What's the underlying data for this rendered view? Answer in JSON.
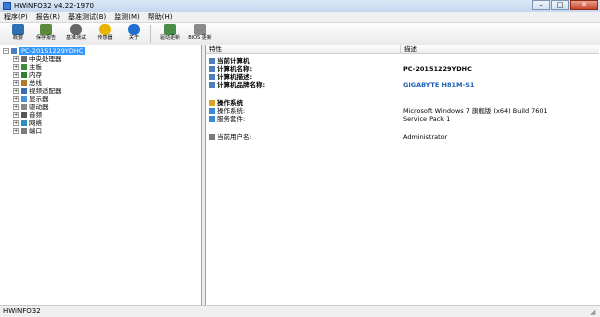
{
  "window": {
    "title": "HWiNFO32 v4.22-1970",
    "minimize": "–",
    "maximize": "□",
    "close": "✕"
  },
  "menu": [
    "程序(P)",
    "报告(R)",
    "基准测试(B)",
    "监测(M)",
    "帮助(H)"
  ],
  "toolbar": [
    {
      "label": "概要",
      "icon": "summary-icon",
      "color": "#2f6fb3"
    },
    {
      "label": "保存报告",
      "icon": "save-report-icon",
      "color": "#5a8a3a"
    },
    {
      "label": "基准测试",
      "icon": "benchmark-icon",
      "color": "#666666"
    },
    {
      "label": "传感器",
      "icon": "sensors-icon",
      "color": "#e8b400"
    },
    {
      "label": "关于",
      "icon": "about-icon",
      "color": "#1f6fd0"
    },
    {
      "label": "驱动更新",
      "icon": "driver-update-icon",
      "color": "#4a8c4a"
    },
    {
      "label": "BIOS 更新",
      "icon": "bios-update-icon",
      "color": "#8a8a8a"
    }
  ],
  "tree": {
    "root": "PC-20151229YDHC",
    "items": [
      "中央处理器",
      "主板",
      "内存",
      "总线",
      "视频适配器",
      "显示器",
      "驱动器",
      "音频",
      "网络",
      "端口"
    ]
  },
  "details": {
    "col_feature": "特性",
    "col_desc": "描述",
    "computer_section": "当前计算机",
    "rows": [
      {
        "label": "计算机名称:",
        "value": "PC-20151229YDHC",
        "bold": true
      },
      {
        "label": "计算机描述:",
        "value": "",
        "bold": true
      },
      {
        "label": "计算机品牌名称:",
        "value": "GIGABYTE H81M-S1",
        "link": true
      }
    ],
    "os_section": "操作系统",
    "os_rows": [
      {
        "label": "操作系统:",
        "value": "Microsoft Windows 7 旗舰版 (x64) Build 7601"
      },
      {
        "label": "服务套件:",
        "value": "Service Pack 1"
      }
    ],
    "user_label": "当前用户名:",
    "user_value": "Administrator"
  },
  "status": "HWiNFO32"
}
